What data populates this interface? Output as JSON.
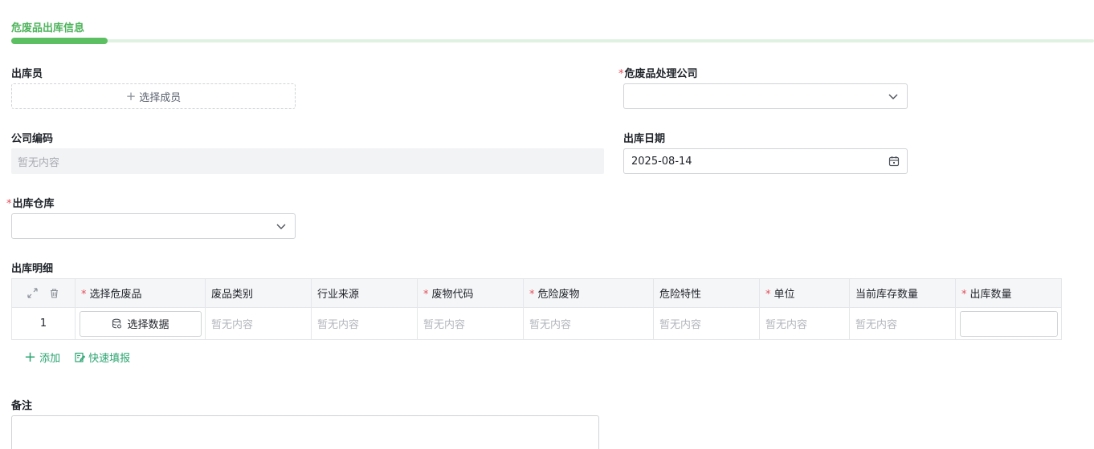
{
  "section": {
    "title": "危废品出库信息"
  },
  "form": {
    "operator_label": "出库员",
    "choose_member_label": "选择成员",
    "company_label": "危废品处理公司",
    "company_value": "",
    "company_code_label": "公司编码",
    "company_code_value": "暂无内容",
    "date_label": "出库日期",
    "date_value": "2025-08-14",
    "warehouse_label": "出库仓库",
    "warehouse_value": "",
    "details_label": "出库明细",
    "remark_label": "备注",
    "required_mark": "*"
  },
  "table": {
    "columns": [
      "选择危废品",
      "废品类别",
      "行业来源",
      "废物代码",
      "危险废物",
      "危险特性",
      "单位",
      "当前库存数量",
      "出库数量"
    ],
    "rows": [
      {
        "index": "1",
        "select_button": "选择数据",
        "category": "暂无内容",
        "industry": "暂无内容",
        "code": "暂无内容",
        "waste": "暂无内容",
        "hazard": "暂无内容",
        "unit": "暂无内容",
        "stock": "暂无内容",
        "quantity": ""
      }
    ]
  },
  "actions": {
    "add": "添加",
    "quick_fill": "快速填报"
  },
  "colors": {
    "accent": "#4cb35a",
    "action": "#2ba471",
    "required": "#e34d59"
  }
}
